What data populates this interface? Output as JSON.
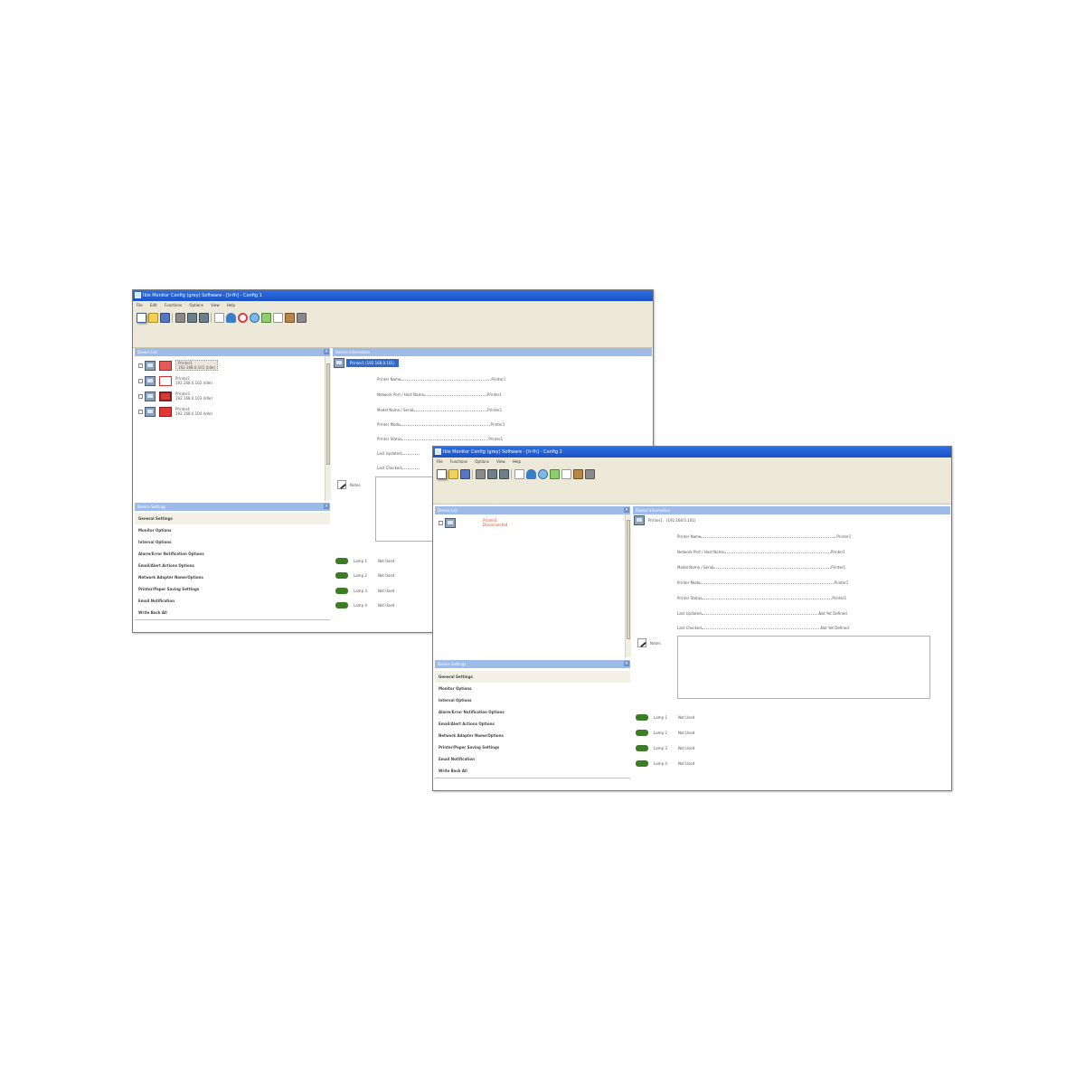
{
  "windows": [
    {
      "title": "Ibis Monitor Config (grey) Software - [Ir-fh] - Config 1",
      "menu": [
        "File",
        "Edit",
        "Functions",
        "Options",
        "View",
        "Help"
      ],
      "device_list_header": "Device List",
      "device_info_header": "Device Information",
      "settings_header": "Device Settings",
      "devices": [
        {
          "type": "printer",
          "line1": "Printer1",
          "line2": "192.168.0.101 (Idle)"
        },
        {
          "type": "scanner",
          "line1": "Printer2",
          "line2": "192.168.0.102 (Idle)"
        },
        {
          "type": "mfp",
          "line1": "Printer3",
          "line2": "192.168.0.103 (Idle)"
        },
        {
          "type": "copier",
          "line1": "Printer4",
          "line2": "192.168.0.104 (Idle)"
        }
      ],
      "info_selected": "Printer1 (192.168.0.101)",
      "info_fields": [
        {
          "key": "Printer Name",
          "value": "Printer1"
        },
        {
          "key": "Network Port / Host Name",
          "value": "Printer1"
        },
        {
          "key": "Model Name / Serial",
          "value": "Printer1"
        },
        {
          "key": "Printer Mode",
          "value": "Printer1"
        },
        {
          "key": "Printer Status",
          "value": "Printer1"
        },
        {
          "key": "Last Updated",
          "value": ""
        },
        {
          "key": "Last Checked",
          "value": ""
        }
      ],
      "notes_label": "Notes",
      "lamps": [
        {
          "name": "Lamp 1",
          "state": "Not Used"
        },
        {
          "name": "Lamp 2",
          "state": "Not Used"
        },
        {
          "name": "Lamp 3",
          "state": "Not Used"
        },
        {
          "name": "Lamp 4",
          "state": "Not Used"
        }
      ],
      "settings": [
        "General Settings",
        "Monitor Options",
        "Interval Options",
        "Alarm/Error Notification Options",
        "Email/Alert Actions Options",
        "Network Adapter Name/Options",
        "Printer/Paper Saving Settings",
        "Email Notification",
        "Write Back All"
      ]
    },
    {
      "title": "Ibis Monitor Config (grey) Software - [Ir-fh] - Config 1",
      "menu": [
        "File",
        "Functions",
        "Options",
        "View",
        "Help"
      ],
      "device_list_header": "Device List",
      "device_info_header": "Device Information",
      "settings_header": "Device Settings",
      "devices": [
        {
          "type": "none",
          "line1": "Printer1",
          "line2": "Disconnected"
        }
      ],
      "info_selected": "Printer1",
      "info_plain": "(192.168.0.101)",
      "info_fields": [
        {
          "key": "Printer Name",
          "value": "Printer1"
        },
        {
          "key": "Network Port / Host Name",
          "value": "Printer1"
        },
        {
          "key": "Model Name / Serial",
          "value": "Printer1"
        },
        {
          "key": "Printer Mode",
          "value": "Printer1"
        },
        {
          "key": "Printer Status",
          "value": "Printer1"
        },
        {
          "key": "Last Updated",
          "value": "Not Yet Defined"
        },
        {
          "key": "Last Checked",
          "value": "Not Yet Defined"
        }
      ],
      "notes_label": "Notes",
      "lamps": [
        {
          "name": "Lamp 1",
          "state": "Not Used"
        },
        {
          "name": "Lamp 2",
          "state": "Not Used"
        },
        {
          "name": "Lamp 3",
          "state": "Not Used"
        },
        {
          "name": "Lamp 4",
          "state": "Not Used"
        }
      ],
      "settings": [
        "General Settings",
        "Monitor Options",
        "Interval Options",
        "Alarm/Error Notification Options",
        "Email/Alert Actions Options",
        "Network Adapter Name/Options",
        "Printer/Paper Saving Settings",
        "Email Notification",
        "Write Back All"
      ]
    }
  ],
  "toolbar_icons": [
    "new-document-icon",
    "open-folder-icon",
    "save-icon",
    "separator",
    "binoculars-icon",
    "print-icon",
    "printer-settings-icon",
    "separator",
    "edit-icon",
    "window-icon",
    "monitor-icon",
    "user-icon",
    "stop-icon",
    "globe-icon",
    "check-icon",
    "copy-icon",
    "tools-icon",
    "wrench-icon"
  ]
}
